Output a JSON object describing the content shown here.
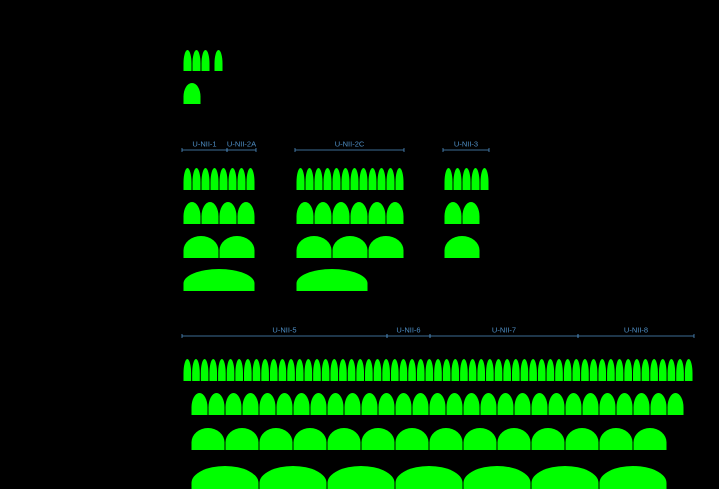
{
  "colors": {
    "channel": "#00ff00",
    "annotation": "#4f8fc6",
    "background": "#000000"
  },
  "legend": {
    "narrow_channels": 4,
    "wide_channels": 1
  },
  "band_5ghz": {
    "bands": [
      {
        "label": "U-NII-1"
      },
      {
        "label": "U-NII-2A"
      },
      {
        "label": "U-NII-2C"
      },
      {
        "label": "U-NII-3"
      }
    ],
    "groups": [
      {
        "name": "unii-1-2a",
        "channels_20": 8,
        "channels_40": 4,
        "channels_80": 2,
        "channels_160": 1
      },
      {
        "name": "unii-2c",
        "channels_20": 12,
        "channels_40": 6,
        "channels_80": 3,
        "channels_160": 1
      },
      {
        "name": "unii-3",
        "channels_20": 5,
        "channels_40": 2,
        "channels_80": 1,
        "channels_160": 0
      }
    ]
  },
  "band_6ghz": {
    "bands": [
      {
        "label": "U-NII-5"
      },
      {
        "label": "U-NII-6"
      },
      {
        "label": "U-NII-7"
      },
      {
        "label": "U-NII-8"
      }
    ],
    "channels_20": 59,
    "channels_40": 29,
    "channels_80": 14,
    "channels_160": 7
  }
}
